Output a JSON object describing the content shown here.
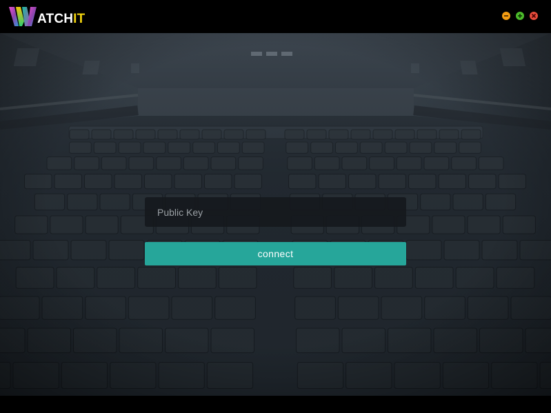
{
  "app": {
    "logo_text_white": "ATCH",
    "logo_text_yellow": "IT",
    "logo_icon": "w-logo-icon"
  },
  "window_controls": {
    "minimize_icon": "minus-icon",
    "maximize_icon": "plus-icon",
    "close_icon": "close-icon"
  },
  "form": {
    "public_key_placeholder": "Public Key",
    "public_key_value": "",
    "connect_label": "connect"
  },
  "colors": {
    "accent": "#26a69a",
    "logo_yellow": "#f0d20e",
    "minimize": "#f39c12",
    "maximize": "#4cba2b",
    "close": "#e74c3c"
  }
}
